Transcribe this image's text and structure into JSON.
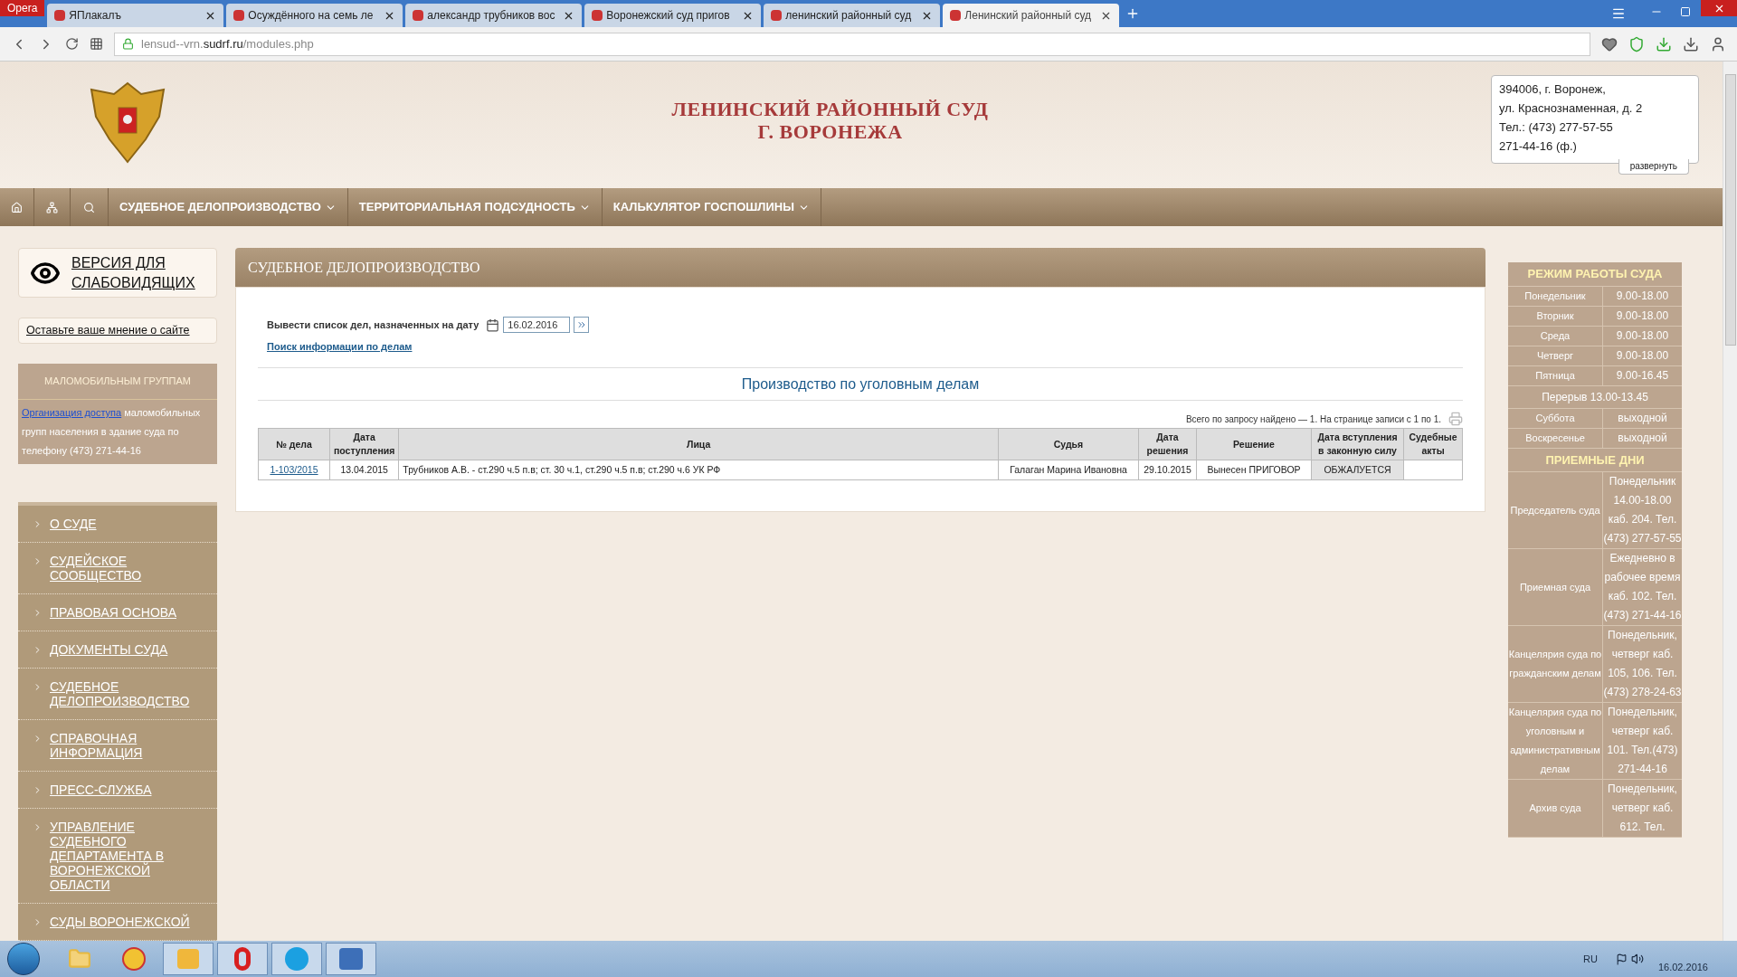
{
  "browser": {
    "menu_button": "Opera",
    "tabs": [
      {
        "title": "ЯПлакалъ",
        "selected": false
      },
      {
        "title": "Осуждённого на семь ле",
        "selected": false
      },
      {
        "title": "александр трубников вос",
        "selected": false
      },
      {
        "title": "Воронежский суд пригов",
        "selected": false
      },
      {
        "title": "ленинский районный суд",
        "selected": false
      },
      {
        "title": "Ленинский районный суд",
        "selected": true
      }
    ],
    "address": {
      "host_prefix": "lensud--vrn.",
      "domain": "sudrf.ru",
      "path": "/modules.php"
    }
  },
  "header": {
    "title_lines": [
      "ЛЕНИНСКИЙ РАЙОННЫЙ СУД",
      "Г. ВОРОНЕЖА"
    ],
    "contact_lines": [
      "394006, г. Воронеж,",
      "ул. Краснознаменная, д. 2",
      "Тел.: (473) 277-57-55",
      "271-44-16 (ф.)"
    ],
    "expand_label": "развернуть"
  },
  "nav": {
    "items": [
      "СУДЕБНОЕ ДЕЛОПРОИЗВОДСТВО",
      "ТЕРРИТОРИАЛЬНАЯ ПОДСУДНОСТЬ",
      "КАЛЬКУЛЯТОР ГОСПОШЛИНЫ"
    ]
  },
  "sidebar": {
    "low_vision_link": "ВЕРСИЯ ДЛЯ СЛАБОВИДЯЩИХ",
    "feedback_link": "Оставьте ваше мнение о сайте",
    "access_box": {
      "title": "МАЛОМОБИЛЬНЫМ ГРУППАМ",
      "link": "Организация доступа",
      "text": "маломобильных групп населения в здание суда по телефону (473) 271-44-16"
    },
    "menu": [
      "О СУДЕ",
      "СУДЕЙСКОЕ СООБЩЕСТВО",
      "ПРАВОВАЯ ОСНОВА",
      "ДОКУМЕНТЫ СУДА",
      "СУДЕБНОЕ ДЕЛОПРОИЗВОДСТВО",
      "СПРАВОЧНАЯ ИНФОРМАЦИЯ",
      "ПРЕСС-СЛУЖБА",
      "УПРАВЛЕНИЕ СУДЕБНОГО ДЕПАРТАМЕНТА В ВОРОНЕЖСКОЙ ОБЛАСТИ",
      "СУДЫ ВОРОНЕЖСКОЙ"
    ]
  },
  "main": {
    "title": "СУДЕБНОЕ ДЕЛОПРОИЗВОДСТВО",
    "date_label": "Вывести список дел, назначенных на дату",
    "date_value": "16.02.2016",
    "search_link": "Поиск информации по делам",
    "section_title": "Производство по уголовным делам",
    "summary": "Всего по запросу найдено — 1. На странице записи с 1 по 1.",
    "table": {
      "columns": [
        "№ дела",
        "Дата поступления",
        "Лица",
        "Судья",
        "Дата решения",
        "Решение",
        "Дата вступления в законную силу",
        "Судебные акты"
      ],
      "rows": [
        {
          "cells": [
            "1-103/2015",
            "13.04.2015",
            "Трубников А.В. - ст.290 ч.5 п.в; ст. 30 ч.1, ст.290 ч.5 п.в; ст.290 ч.6 УК РФ",
            "Галаган Марина Ивановна",
            "29.10.2015",
            "Вынесен ПРИГОВОР",
            "ОБЖАЛУЕТСЯ",
            ""
          ]
        }
      ]
    }
  },
  "schedule": {
    "rows": [
      {
        "kind": "heading",
        "label": "РЕЖИМ РАБОТЫ СУДА"
      },
      {
        "kind": "pair",
        "label": "Понедельник",
        "value": "9.00-18.00"
      },
      {
        "kind": "pair",
        "label": "Вторник",
        "value": "9.00-18.00"
      },
      {
        "kind": "pair",
        "label": "Среда",
        "value": "9.00-18.00"
      },
      {
        "kind": "pair",
        "label": "Четверг",
        "value": "9.00-18.00"
      },
      {
        "kind": "pair",
        "label": "Пятница",
        "value": "9.00-16.45"
      },
      {
        "kind": "full",
        "label": "Перерыв 13.00-13.45"
      },
      {
        "kind": "pair",
        "label": "Суббота",
        "value": "выходной"
      },
      {
        "kind": "pair",
        "label": "Воскресенье",
        "value": "выходной"
      },
      {
        "kind": "heading",
        "label": "ПРИЕМНЫЕ ДНИ"
      },
      {
        "kind": "pair",
        "label": "Председатель суда",
        "value": "Понедельник 14.00-18.00 каб. 204. Тел. (473) 277-57-55"
      },
      {
        "kind": "pair",
        "label": "Приемная суда",
        "value": "Ежедневно в рабочее время каб. 102. Тел. (473) 271-44-16"
      },
      {
        "kind": "pair",
        "label": "Канцелярия суда по гражданским делам",
        "value": "Понедельник, четверг каб. 105, 106. Тел. (473) 278-24-63"
      },
      {
        "kind": "pair",
        "label": "Канцелярия суда по уголовным и административным делам",
        "value": "Понедельник, четверг каб. 101. Тел.(473) 271-44-16"
      },
      {
        "kind": "pair",
        "label": "Архив суда",
        "value": "Понедельник, четверг каб. 612. Тел."
      }
    ]
  },
  "taskbar": {
    "language": "RU",
    "date": "16.02.2016"
  }
}
